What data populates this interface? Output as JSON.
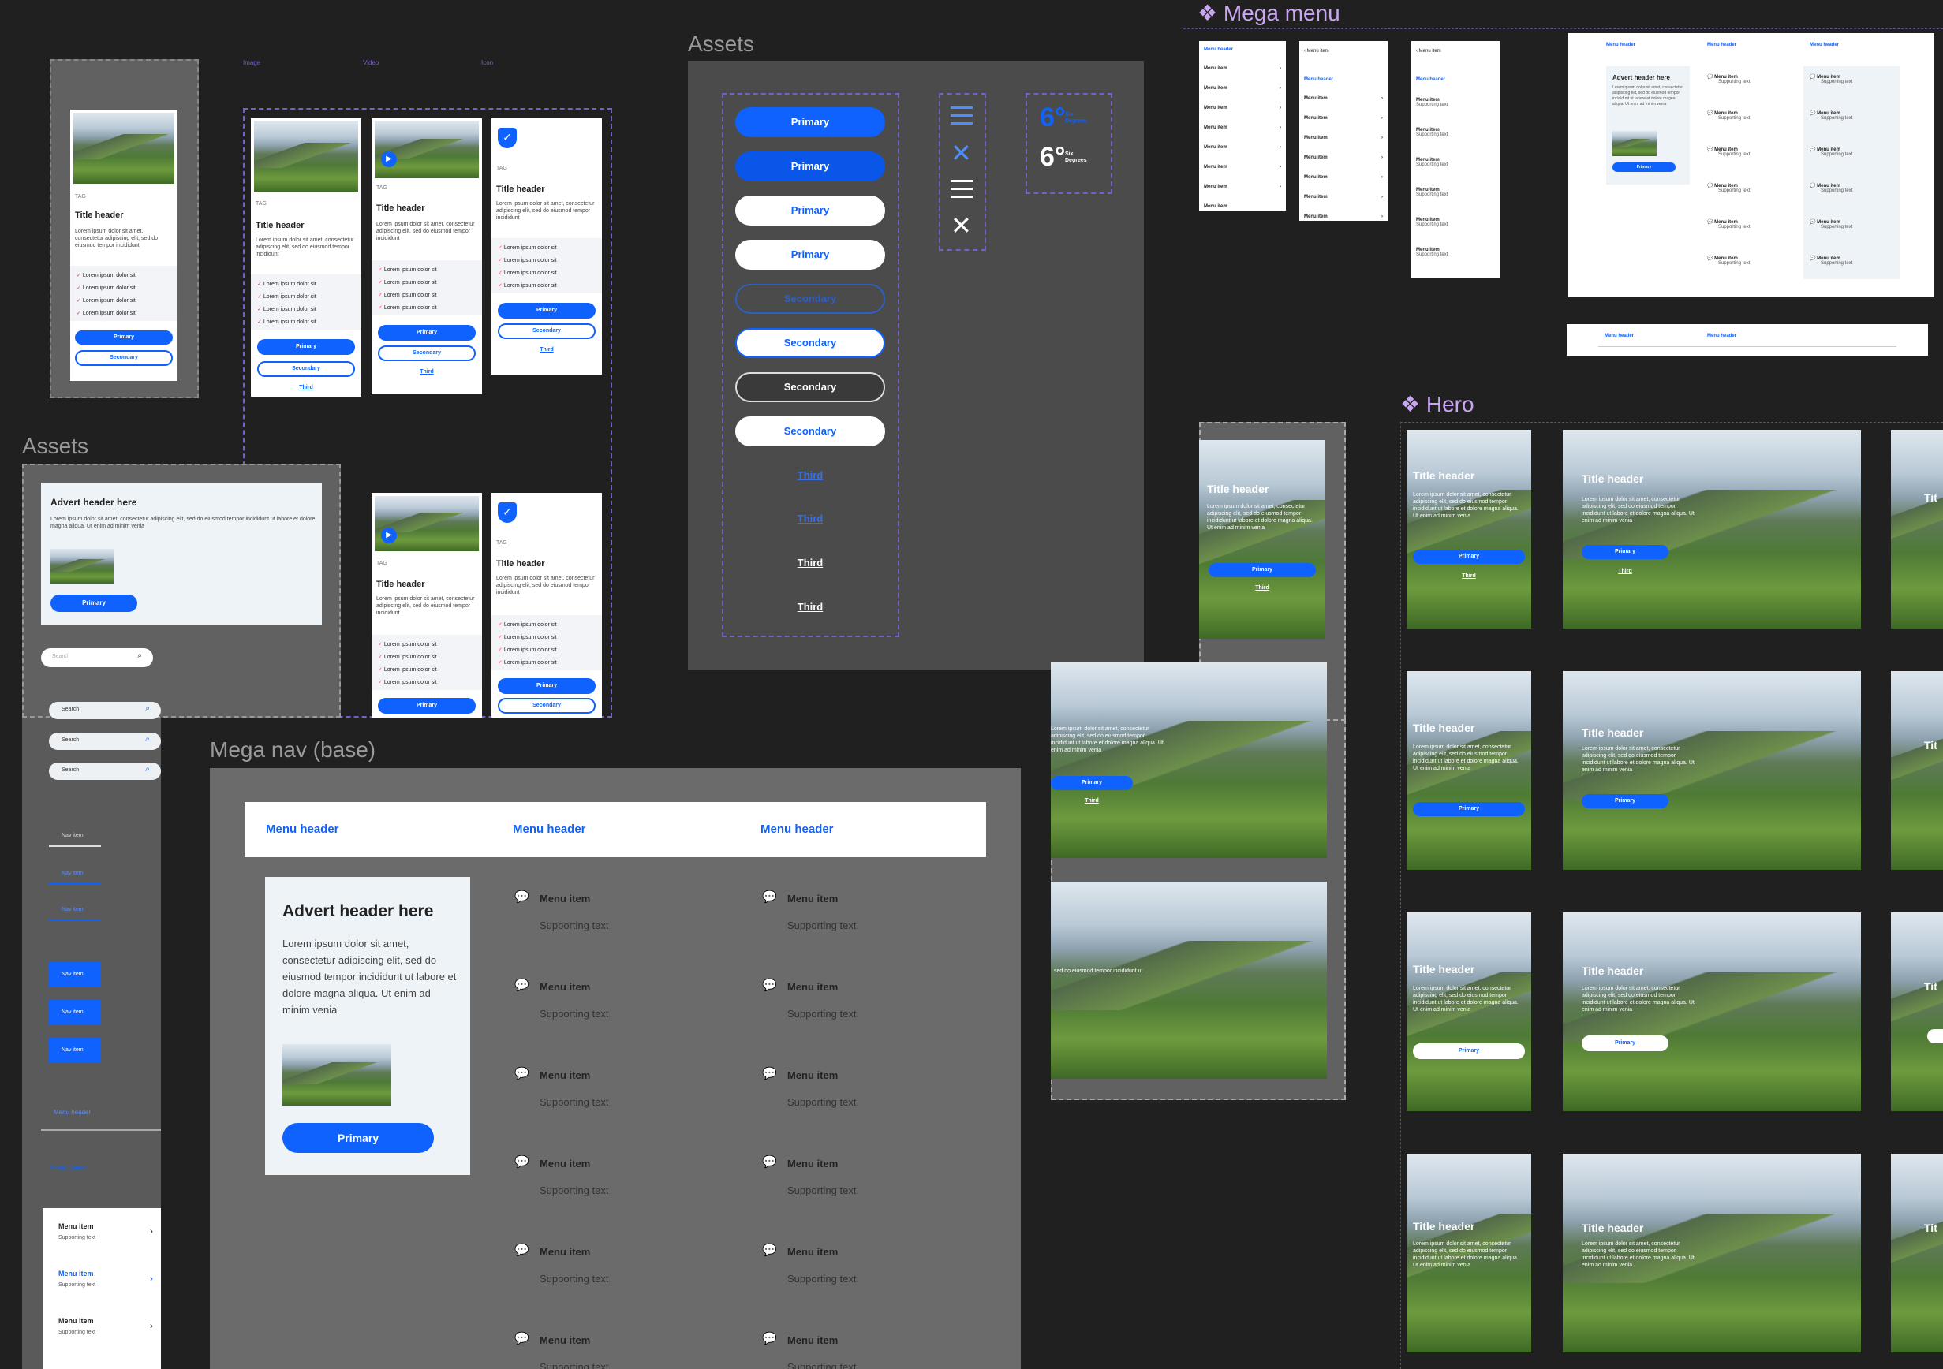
{
  "labels": {
    "assets1": "Assets",
    "assets2": "Assets",
    "mega_menu": "Mega menu",
    "mega_nav": "Mega nav (base)",
    "hero": "Hero",
    "image": "Image",
    "video": "Video",
    "icon": "Icon"
  },
  "card": {
    "tag": "TAG",
    "title": "Title header",
    "body": "Lorem ipsum dolor sit amet, consectetur adipiscing elit, sed do eiusmod tempor incididunt",
    "list_item": "Lorem ipsum dolor sit",
    "primary": "Primary",
    "secondary": "Secondary",
    "third": "Third"
  },
  "advert": {
    "title": "Advert header here",
    "body_long": "Lorem ipsum dolor sit amet, consectetur adipiscing elit, sed do eiusmod tempor incididunt ut labore et dolore magna aliqua. Ut enim ad minim venia",
    "primary": "Primary"
  },
  "search": {
    "placeholder": "Search"
  },
  "nav": {
    "item": "Nav item",
    "menu_header": "Menu header"
  },
  "menu": {
    "item": "Menu item",
    "supporting": "Supporting text",
    "back": "Menu item"
  },
  "buttons": {
    "primary": "Primary",
    "secondary": "Secondary",
    "third": "Third"
  },
  "logo": {
    "mark": "6°",
    "line1": "Six",
    "line2": "Degrees"
  },
  "hero": {
    "title": "Title header",
    "body": "Lorem ipsum dolor sit amet, consectetur adipiscing elit, sed do eiusmod tempor incididunt ut labore et dolore magna aliqua. Ut enim ad minim venia",
    "body_short": "sed do eiusmod tempor incididunt ut",
    "primary": "Primary",
    "third": "Third"
  },
  "colors": {
    "brand": "#0f62fe",
    "check": "#e4495a",
    "frame": "#7a5ec8",
    "mega_label": "#c9a6f2"
  }
}
